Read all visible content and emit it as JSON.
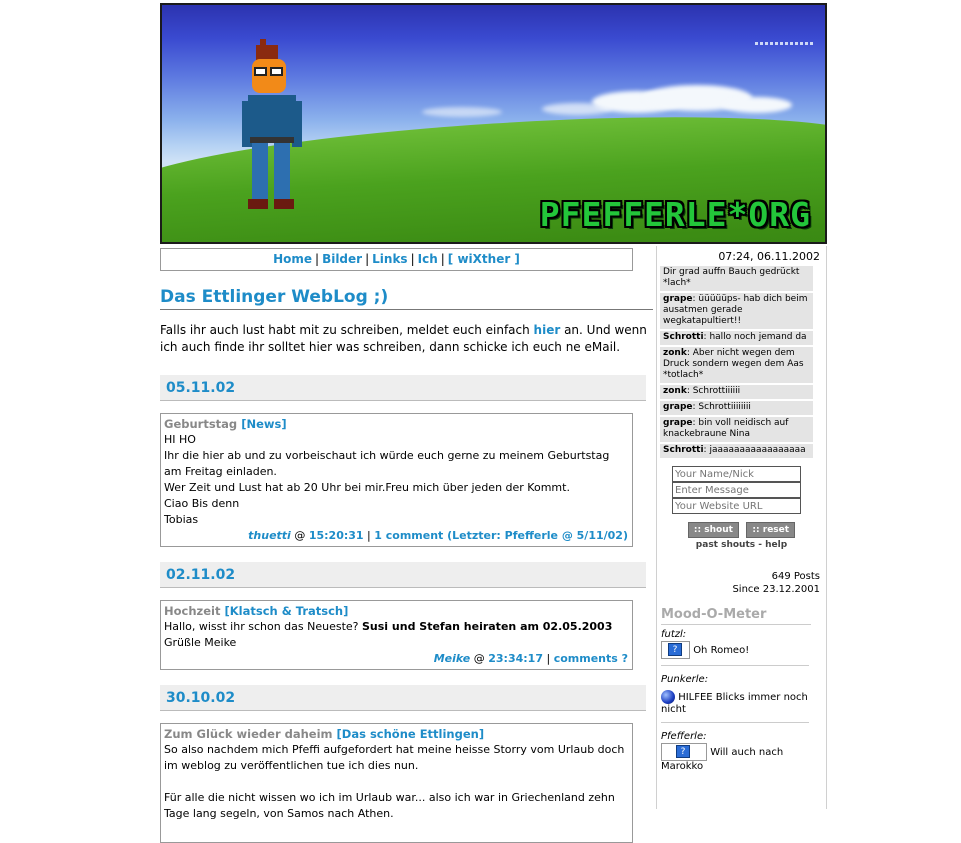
{
  "header": {
    "logo_text": "PFEFFERLE*ORG"
  },
  "nav": {
    "items": [
      {
        "label": "Home"
      },
      {
        "label": "Bilder"
      },
      {
        "label": "Links"
      },
      {
        "label": "Ich"
      },
      {
        "label": "[ wiXther ]"
      }
    ]
  },
  "main": {
    "title": "Das Ettlinger WebLog ;)",
    "intro_before": "Falls ihr auch lust habt mit zu schreiben, meldet euch einfach ",
    "intro_link": "hier",
    "intro_after": " an. Und wenn ich auch finde ihr solltet hier was schreiben, dann schicke ich euch ne eMail.",
    "days": [
      {
        "date": "05.11.02",
        "post": {
          "title": "Geburtstag",
          "category": "[News]",
          "lines": [
            "HI HO",
            "Ihr die hier ab und zu vorbeischaut ich würde euch gerne zu meinem Geburtstag am Freitag einladen.",
            "Wer Zeit und Lust hat ab 20 Uhr bei mir.Freu mich über jeden der Kommt.",
            "Ciao Bis denn",
            "Tobias"
          ],
          "author": "thuetti",
          "at": "@",
          "time": "15:20:31",
          "comments": "1 comment (Letzter: Pfefferle @ 5/11/02)"
        }
      },
      {
        "date": "02.11.02",
        "post": {
          "title": "Hochzeit",
          "category": "[Klatsch & Tratsch]",
          "line1_before": "Hallo, wisst ihr schon das Neueste? ",
          "line1_bold": "Susi und Stefan heiraten am 02.05.2003",
          "line2": "Grüßle Meike",
          "author": "Meike",
          "at": "@",
          "time": "23:34:17",
          "comments": "comments ?"
        }
      },
      {
        "date": "30.10.02",
        "post": {
          "title": "Zum Glück wieder daheim",
          "category": "[Das schöne Ettlingen]",
          "line1": "So also nachdem mich Pfeffi aufgefordert hat meine heisse Storry vom Urlaub doch im weblog zu veröffentlichen tue ich dies nun.",
          "line2": "Für alle die nicht wissen wo ich im Urlaub war... also ich war in Griechenland zehn Tage lang segeln, von Samos nach Athen."
        }
      }
    ]
  },
  "sidebar": {
    "clock": "07:24, 06.11.2002",
    "shouts": [
      {
        "name": "",
        "text": "Dir grad auffn Bauch gedrückt *lach*"
      },
      {
        "name": "grape",
        "text": ": üüüüüps- hab dich beim ausatmen gerade wegkatapultiert!!"
      },
      {
        "name": "Schrotti",
        "text": ": hallo noch jemand da"
      },
      {
        "name": "zonk",
        "text": ": Aber nicht wegen dem Druck sondern wegen dem Aas *totlach*"
      },
      {
        "name": "zonk",
        "text": ": Schrottiiiiii"
      },
      {
        "name": "grape",
        "text": ": Schrottiiiiiiii"
      },
      {
        "name": "grape",
        "text": ": bin voll neidisch auf knackebraune Nina"
      },
      {
        "name": "Schrotti",
        "text": ": jaaaaaaaaaaaaaaaaa"
      }
    ],
    "name_placeholder": "Your Name/Nick",
    "message_placeholder": "Enter Message",
    "website_placeholder": "Your Website URL",
    "shout_label": ":: shout",
    "reset_label": ":: reset",
    "past_shouts": "past shouts",
    "help": "help",
    "dash": " - ",
    "posts_count": "649 Posts",
    "since": "Since 23.12.2001",
    "mood_title": "Mood-O-Meter",
    "moods": [
      {
        "who": "futzl:",
        "text": "Oh Romeo!",
        "icon": "question-icon"
      },
      {
        "who": "Punkerle:",
        "text": "HILFEE Blicks immer noch nicht",
        "icon": "blue-ball-icon"
      },
      {
        "who": "Pfefferle:",
        "text": "Will auch nach Marokko",
        "icon": "question-icon"
      }
    ]
  },
  "colors": {
    "accent": "#1e8cc8",
    "date_bar": "#eeeeee",
    "shout_bg": "#e4e4e4"
  }
}
